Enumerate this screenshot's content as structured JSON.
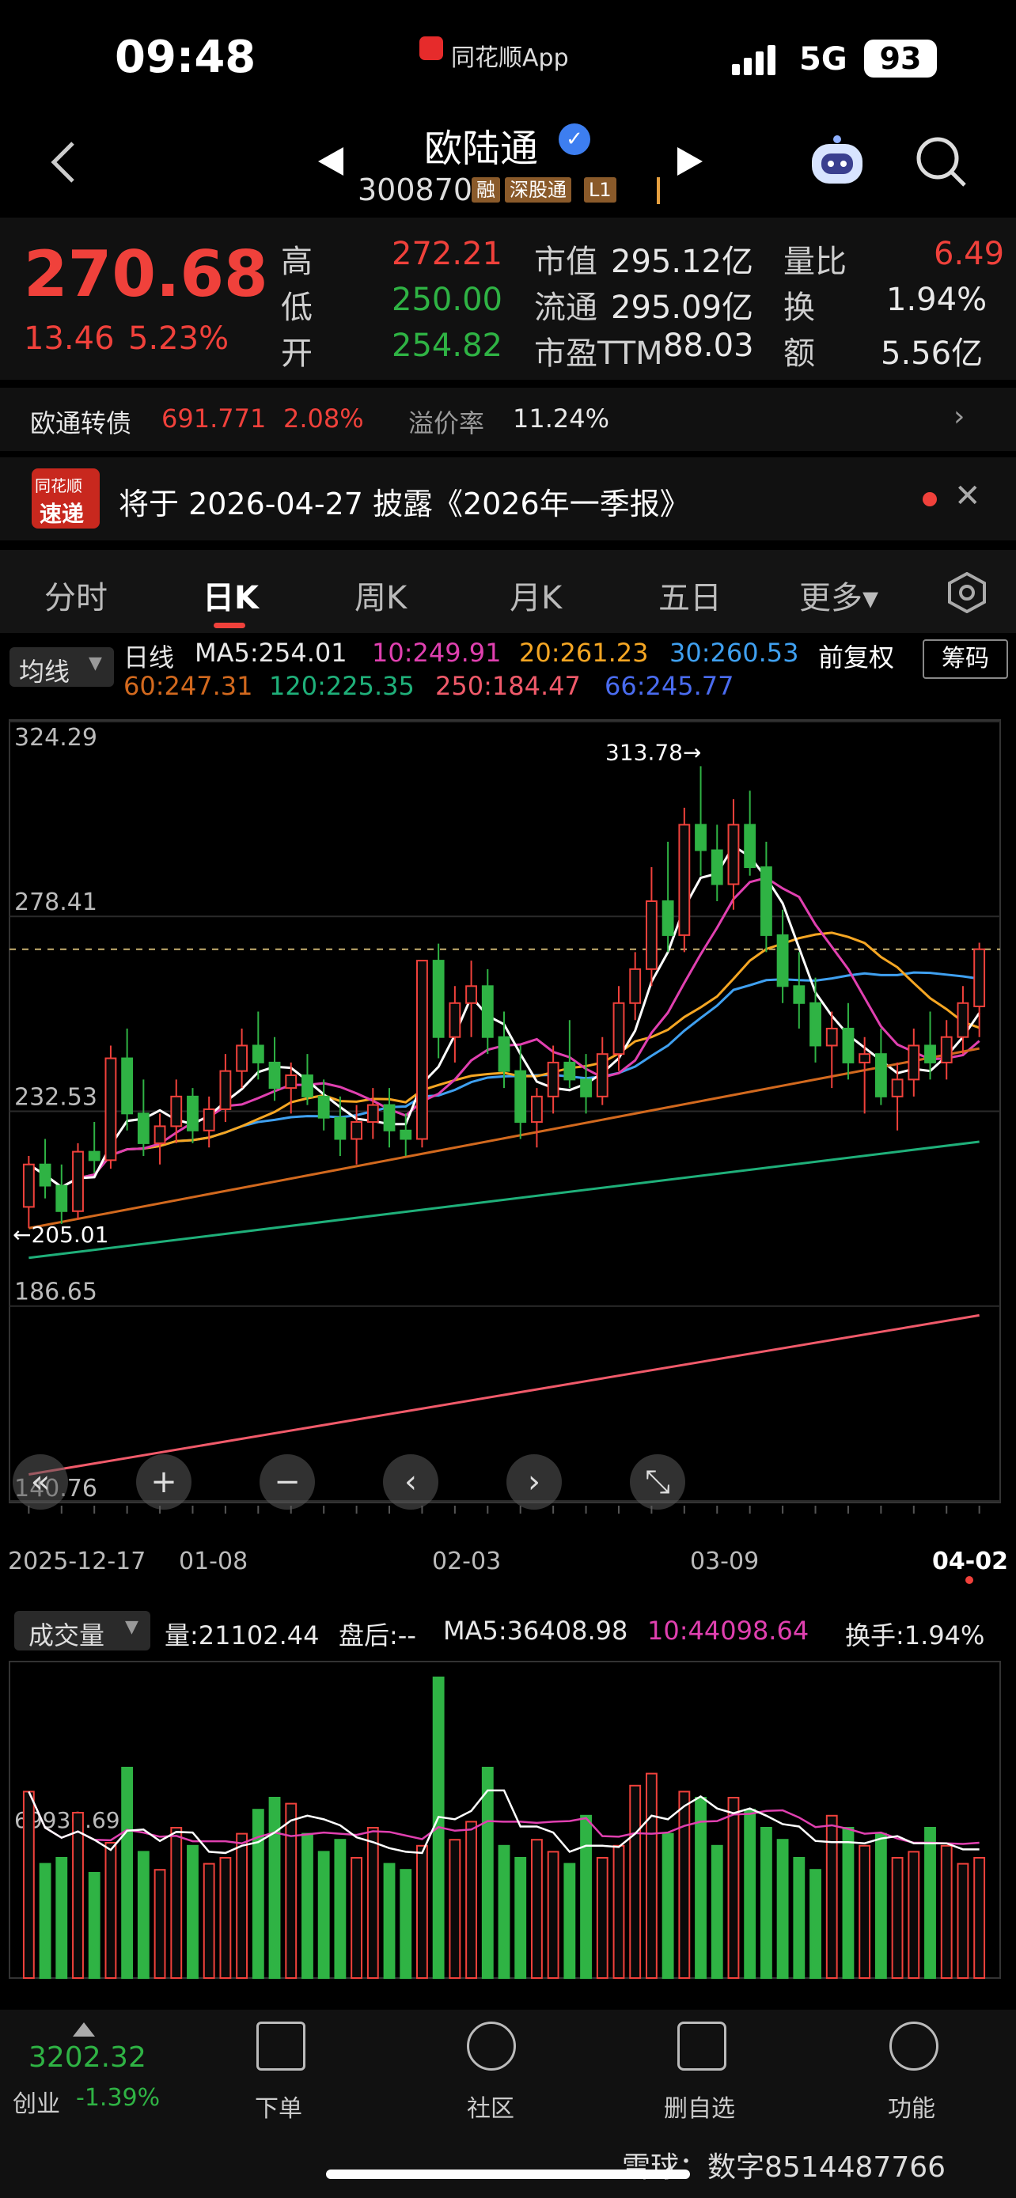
{
  "status_bar": {
    "time": "09:48",
    "app_name": "同花顺App",
    "network": "5G",
    "battery": "93"
  },
  "header": {
    "stock_name": "欧陆通",
    "verified_icon": "check",
    "stock_code": "300870",
    "tags": [
      "融",
      "深股通",
      "L1"
    ]
  },
  "quote": {
    "last_price": "270.68",
    "change": "13.46",
    "change_pct": "5.23%",
    "rows": [
      [
        {
          "label": "高",
          "value": "272.21",
          "color": "red"
        },
        {
          "label": "市值",
          "value": "295.12亿",
          "color": "white"
        },
        {
          "label": "量比",
          "value": "6.49",
          "color": "red"
        }
      ],
      [
        {
          "label": "低",
          "value": "250.00",
          "color": "green"
        },
        {
          "label": "流通",
          "value": "295.09亿",
          "color": "white"
        },
        {
          "label": "换",
          "value": "1.94%",
          "color": "white"
        }
      ],
      [
        {
          "label": "开",
          "value": "254.82",
          "color": "green"
        },
        {
          "label": "市盈TTM",
          "value": "88.03",
          "color": "white"
        },
        {
          "label": "额",
          "value": "5.56亿",
          "color": "white"
        }
      ]
    ]
  },
  "cb_row": {
    "name": "欧通转债",
    "price": "691.771",
    "pct": "2.08%",
    "premium_label": "溢价率",
    "premium": "11.24%"
  },
  "notice": {
    "logo_line1": "同花顺",
    "logo_line2": "速递",
    "text": "将于 2026-04-27 披露《2026年一季报》"
  },
  "tabs": [
    {
      "label": "分时",
      "active": false
    },
    {
      "label": "日K",
      "active": true
    },
    {
      "label": "周K",
      "active": false
    },
    {
      "label": "月K",
      "active": false
    },
    {
      "label": "五日",
      "active": false
    },
    {
      "label": "更多▾",
      "active": false
    }
  ],
  "chart_toolbar": {
    "indicator_select": "均线",
    "ma_items": [
      {
        "text": "日线",
        "color": "#e8e8e8"
      },
      {
        "text": "MA5:254.01",
        "color": "#e8e8e8"
      },
      {
        "text": "10:249.91",
        "color": "#e040b0"
      },
      {
        "text": "20:261.23",
        "color": "#f5a623"
      },
      {
        "text": "30:260.53",
        "color": "#3fa0f0"
      }
    ],
    "ma_items2": [
      {
        "text": "60:247.31",
        "color": "#d2691e"
      },
      {
        "text": "120:225.35",
        "color": "#1fb07a"
      },
      {
        "text": "250:184.47",
        "color": "#f05a6a"
      },
      {
        "text": "66:245.77",
        "color": "#4a6cf0"
      }
    ],
    "adjust": "前复权",
    "chips_button": "筹码"
  },
  "chart_data": {
    "type": "candlestick",
    "y_ticks": [
      "324.29",
      "278.41",
      "232.53",
      "186.65",
      "140.76"
    ],
    "ylim": [
      140.76,
      324.29
    ],
    "x_ticks": [
      "2025-12-17",
      "01-08",
      "02-03",
      "03-09",
      "04-02"
    ],
    "annotations": {
      "high_label": "313.78→",
      "low_label": "←205.01"
    },
    "candles": [
      [
        210,
        222,
        205,
        220
      ],
      [
        220,
        226,
        212,
        215
      ],
      [
        215,
        220,
        206,
        209
      ],
      [
        209,
        225,
        207,
        223
      ],
      [
        223,
        230,
        218,
        221
      ],
      [
        221,
        248,
        219,
        245
      ],
      [
        245,
        252,
        228,
        232
      ],
      [
        232,
        240,
        222,
        225
      ],
      [
        225,
        232,
        220,
        229
      ],
      [
        229,
        240,
        225,
        236
      ],
      [
        236,
        238,
        225,
        228
      ],
      [
        228,
        236,
        224,
        233
      ],
      [
        233,
        246,
        230,
        242
      ],
      [
        242,
        252,
        238,
        248
      ],
      [
        248,
        256,
        240,
        244
      ],
      [
        244,
        250,
        235,
        238
      ],
      [
        238,
        244,
        232,
        241
      ],
      [
        241,
        246,
        234,
        236
      ],
      [
        236,
        240,
        228,
        231
      ],
      [
        231,
        236,
        222,
        226
      ],
      [
        226,
        234,
        220,
        230
      ],
      [
        230,
        238,
        226,
        234
      ],
      [
        234,
        238,
        224,
        228
      ],
      [
        228,
        232,
        222,
        226
      ],
      [
        226,
        244,
        224,
        268
      ],
      [
        268,
        272,
        245,
        250
      ],
      [
        250,
        262,
        244,
        258
      ],
      [
        258,
        268,
        250,
        262
      ],
      [
        262,
        266,
        246,
        250
      ],
      [
        250,
        256,
        238,
        242
      ],
      [
        242,
        248,
        226,
        230
      ],
      [
        230,
        238,
        224,
        236
      ],
      [
        236,
        248,
        232,
        244
      ],
      [
        244,
        254,
        238,
        240
      ],
      [
        240,
        246,
        232,
        236
      ],
      [
        236,
        250,
        234,
        246
      ],
      [
        246,
        262,
        242,
        258
      ],
      [
        258,
        270,
        254,
        266
      ],
      [
        266,
        290,
        262,
        282
      ],
      [
        282,
        296,
        270,
        274
      ],
      [
        274,
        304,
        270,
        300
      ],
      [
        300,
        313.78,
        288,
        294
      ],
      [
        294,
        300,
        282,
        286
      ],
      [
        286,
        306,
        280,
        300
      ],
      [
        300,
        308,
        288,
        290
      ],
      [
        290,
        296,
        270,
        274
      ],
      [
        274,
        280,
        258,
        262
      ],
      [
        262,
        270,
        252,
        258
      ],
      [
        258,
        264,
        244,
        248
      ],
      [
        248,
        256,
        238,
        252
      ],
      [
        252,
        258,
        240,
        244
      ],
      [
        244,
        250,
        232,
        246
      ],
      [
        246,
        252,
        234,
        236
      ],
      [
        236,
        244,
        228,
        240
      ],
      [
        240,
        252,
        236,
        248
      ],
      [
        248,
        256,
        240,
        244
      ],
      [
        244,
        254,
        240,
        250
      ],
      [
        250,
        262,
        246,
        258
      ],
      [
        257.22,
        272.21,
        250,
        270.68
      ]
    ]
  },
  "chart_controls": [
    "«",
    "+",
    "−",
    "‹",
    "›",
    "⤡"
  ],
  "volume": {
    "indicator_select": "成交量",
    "items": [
      {
        "text": "量:21102.44",
        "color": "#e8e8e8"
      },
      {
        "text": "盘后:--",
        "color": "#e8e8e8"
      },
      {
        "text": "MA5:36408.98",
        "color": "#e8e8e8"
      },
      {
        "text": "10:44098.64",
        "color": "#e040b0"
      },
      {
        "text": "换手:1.94%",
        "color": "#e8e8e8"
      }
    ],
    "y_tick": "69930.69",
    "bars": [
      62,
      38,
      40,
      55,
      35,
      45,
      70,
      42,
      36,
      50,
      44,
      38,
      40,
      48,
      56,
      60,
      58,
      48,
      42,
      46,
      40,
      50,
      38,
      36,
      44,
      100,
      46,
      52,
      70,
      44,
      40,
      46,
      42,
      38,
      54,
      40,
      44,
      64,
      68,
      48,
      62,
      60,
      44,
      60,
      56,
      50,
      46,
      40,
      36,
      54,
      50,
      44,
      48,
      40,
      42,
      50,
      44,
      38,
      40
    ]
  },
  "bottom_nav": {
    "index_value": "3202.32",
    "index_name": "创业",
    "index_pct": "-1.39%",
    "items": [
      "下单",
      "社区",
      "删自选",
      "功能"
    ]
  },
  "watermark": "雪球：数字8514487766"
}
